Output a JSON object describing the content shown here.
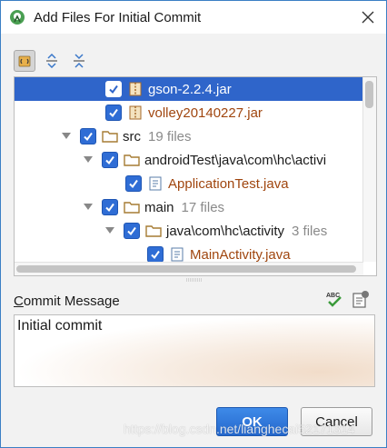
{
  "window": {
    "title": "Add Files For Initial Commit"
  },
  "toolbar": {
    "buttons": [
      {
        "icon": "group-by-directory-icon",
        "active": true
      },
      {
        "icon": "expand-all-icon",
        "active": false
      },
      {
        "icon": "collapse-all-icon",
        "active": false
      }
    ]
  },
  "tree": {
    "rows": [
      {
        "label": "gson-2.2.4.jar",
        "count": "",
        "icon": "jar-icon",
        "type": "file",
        "selected": true,
        "toggle": ""
      },
      {
        "label": "volley20140227.jar",
        "count": "",
        "icon": "jar-icon",
        "type": "file",
        "selected": false,
        "toggle": ""
      },
      {
        "label": "src",
        "count": "19 files",
        "icon": "folder-icon",
        "type": "folder",
        "selected": false,
        "toggle": "expanded"
      },
      {
        "label": "androidTest\\java\\com\\hc\\activi",
        "count": "",
        "icon": "folder-icon",
        "type": "folder",
        "selected": false,
        "toggle": "expanded"
      },
      {
        "label": "ApplicationTest.java",
        "count": "",
        "icon": "java-file-icon",
        "type": "file",
        "selected": false,
        "toggle": ""
      },
      {
        "label": "main",
        "count": "17 files",
        "icon": "folder-icon",
        "type": "folder",
        "selected": false,
        "toggle": "expanded"
      },
      {
        "label": "java\\com\\hc\\activity",
        "count": "3 files",
        "icon": "folder-icon",
        "type": "folder",
        "selected": false,
        "toggle": "expanded"
      },
      {
        "label": "MainActivity.java",
        "count": "",
        "icon": "java-file-icon",
        "type": "file",
        "selected": false,
        "toggle": ""
      }
    ]
  },
  "commit": {
    "label_mnemonic": "C",
    "label_rest": "ommit Message",
    "message": "Initial commit",
    "spellcheck_icon": "spellcheck-icon",
    "history_icon": "commit-history-icon"
  },
  "buttons": {
    "ok": "OK",
    "cancel": "Cancel"
  },
  "watermark": "https://blog.csdn.net/lianghecai52171314",
  "colors": {
    "accent": "#2f65ca",
    "file_text": "#a0460f",
    "count_text": "#8a8a8a"
  }
}
